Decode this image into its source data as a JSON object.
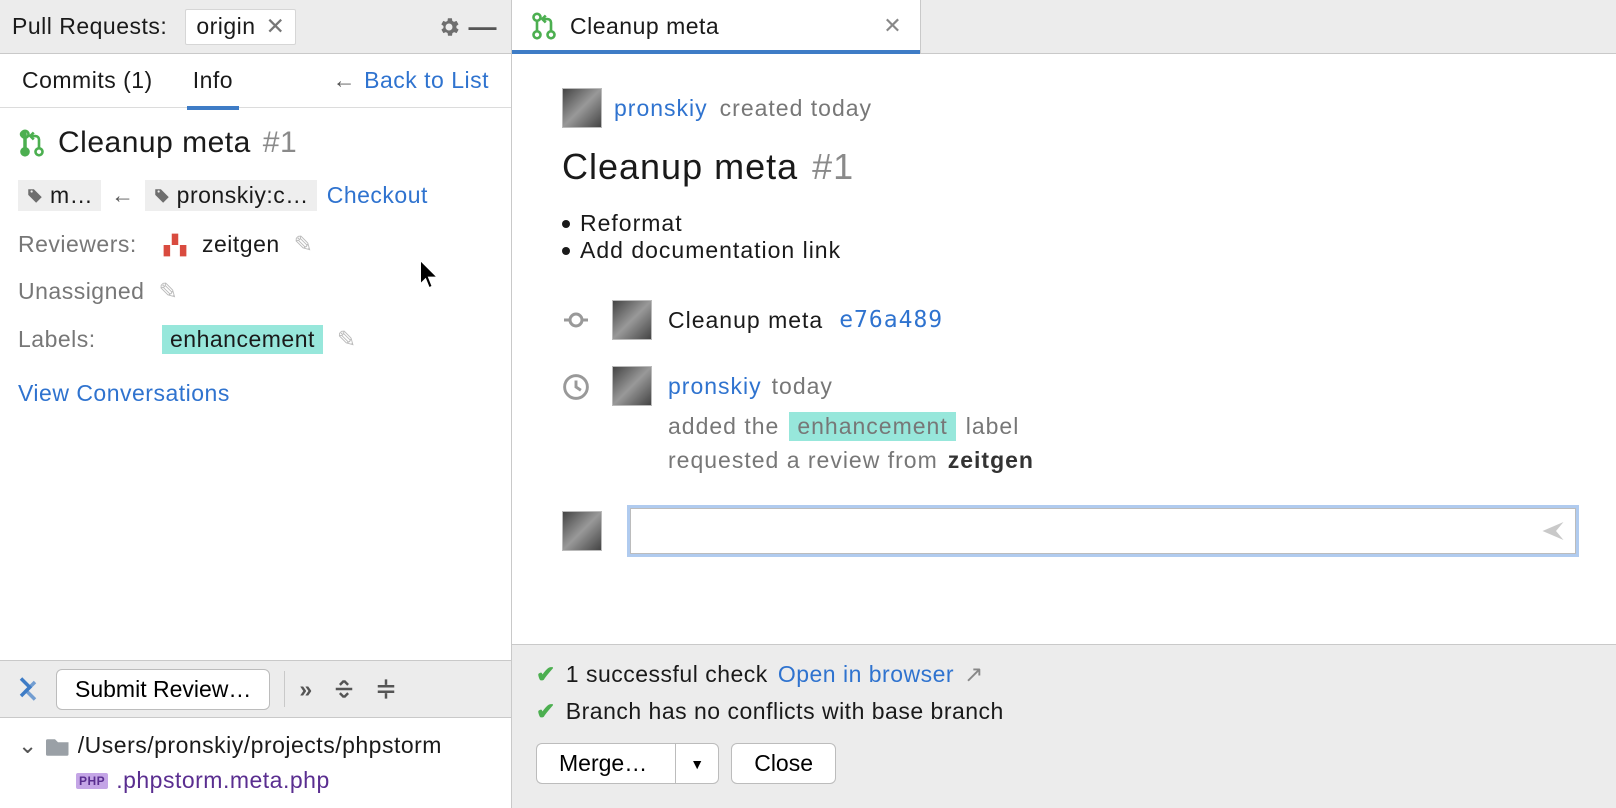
{
  "left": {
    "header_title": "Pull Requests:",
    "remote_chip": "origin",
    "tabs": {
      "commits": "Commits (1)",
      "info": "Info"
    },
    "back": "Back to List",
    "pr_title": "Cleanup meta",
    "pr_number": "#1",
    "branch_target": "m…",
    "branch_source": "pronskiy:c…",
    "checkout": "Checkout",
    "reviewers_label": "Reviewers:",
    "reviewer_name": "zeitgen",
    "assignee": "Unassigned",
    "labels_label": "Labels:",
    "label_value": "enhancement",
    "view_conv": "View Conversations",
    "submit": "Submit Review…",
    "tree_root": "/Users/pronskiy/projects/phpstorm",
    "php_badge": "PHP",
    "file_name": ".phpstorm.meta.php"
  },
  "right": {
    "tab_title": "Cleanup meta",
    "author": "pronskiy",
    "created": "created today",
    "title": "Cleanup meta",
    "number": "#1",
    "bullet1": "Reformat",
    "bullet2": "Add documentation link",
    "commit_msg": "Cleanup meta",
    "commit_hash": "e76a489",
    "event_user": "pronskiy",
    "event_time": "today",
    "event_added_pre": "added the",
    "event_label": "enhancement",
    "event_added_post": "label",
    "event_review_pre": "requested a review from",
    "event_review_user": "zeitgen",
    "footer_check": "1 successful check",
    "footer_open": "Open in browser",
    "footer_branch": "Branch has no conflicts with base branch",
    "merge": "Merge…",
    "close": "Close"
  }
}
